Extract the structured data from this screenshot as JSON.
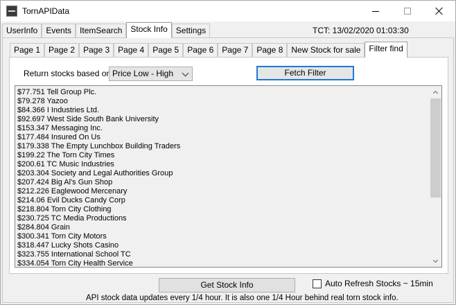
{
  "window": {
    "title": "TornAPIData"
  },
  "main_tabs": [
    "UserInfo",
    "Events",
    "ItemSearch",
    "Stock Info",
    "Settings"
  ],
  "main_active": "Stock Info",
  "tct": "TCT: 13/02/2020 01:03:30",
  "sub_tabs": [
    "Page 1",
    "Page 2",
    "Page 3",
    "Page 4",
    "Page 5",
    "Page 6",
    "Page 7",
    "Page 8",
    "New Stock for sale",
    "Filter find"
  ],
  "sub_active": "Filter find",
  "filter": {
    "label": "Return stocks based on",
    "selected": "Price Low - High",
    "fetch_label": "Fetch Filter"
  },
  "stocks": [
    "$77.751 Tell Group Plc.",
    "$79.278 Yazoo",
    "$84.366 I Industries Ltd.",
    "$92.697 West Side South Bank University",
    "$153.347 Messaging Inc.",
    "$177.484 Insured On Us",
    "$179.338 The Empty Lunchbox Building Traders",
    "$199.22 The Torn City Times",
    "$200.61 TC Music Industries",
    "$203.304 Society and Legal Authorities Group",
    "$207.424 Big Al's Gun Shop",
    "$212.226 Eaglewood Mercenary",
    "$214.06 Evil Ducks Candy Corp",
    "$218.804 Torn City Clothing",
    "$230.725 TC Media Productions",
    "$284.804 Grain",
    "$300.341 Torn City Motors",
    "$318.447 Lucky Shots Casino",
    "$323.755 International School TC",
    "$334.054 Torn City Health Service"
  ],
  "bottom": {
    "get_label": "Get Stock Info",
    "auto_refresh_label": "Auto Refresh Stocks ~ 15min",
    "auto_refresh_checked": false,
    "footer": "API stock data updates every 1/4 hour.   It is also one 1/4 Hour behind real torn stock info."
  }
}
